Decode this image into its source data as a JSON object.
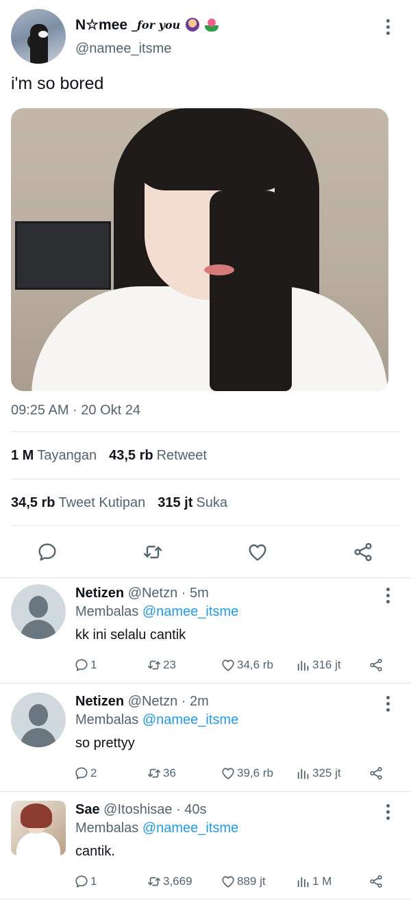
{
  "post": {
    "display_name": "N☆mee",
    "name_suffix": "_for you",
    "handle": "@namee_itsme",
    "text": "i'm so bored",
    "timestamp": "09:25 AM · 20 Okt 24",
    "stats": {
      "views_count": "1 M",
      "views_label": "Tayangan",
      "retweets_count": "43,5 rb",
      "retweets_label": "Retweet",
      "quotes_count": "34,5 rb",
      "quotes_label": "Tweet Kutipan",
      "likes_count": "315 jt",
      "likes_label": "Suka"
    },
    "icons": [
      "reply-icon",
      "retweet-icon",
      "like-icon",
      "share-icon"
    ]
  },
  "replies": [
    {
      "name": "Netizen",
      "meta": "@Netzn · 5m",
      "replying_prefix": "Membalas",
      "replying_to": "@namee_itsme",
      "text": "kk ini selalu cantik",
      "reply_count": "1",
      "retweet_count": "23",
      "like_count": "34,6 rb",
      "view_count": "316 jt"
    },
    {
      "name": "Netizen",
      "meta": "@Netzn · 2m",
      "replying_prefix": "Membalas",
      "replying_to": "@namee_itsme",
      "text": "so prettyy",
      "reply_count": "2",
      "retweet_count": "36",
      "like_count": "39,6 rb",
      "view_count": "325 jt"
    },
    {
      "name": "Sae",
      "meta": "@Itoshisae · 40s",
      "replying_prefix": "Membalas",
      "replying_to": "@namee_itsme",
      "text": "cantik.",
      "reply_count": "1",
      "retweet_count": "3,669",
      "like_count": "889 jt",
      "view_count": "1 M"
    }
  ],
  "colors": {
    "text": "#0f1419",
    "secondary": "#536471",
    "link": "#1d9bf0",
    "divider": "#e1e8ed"
  }
}
